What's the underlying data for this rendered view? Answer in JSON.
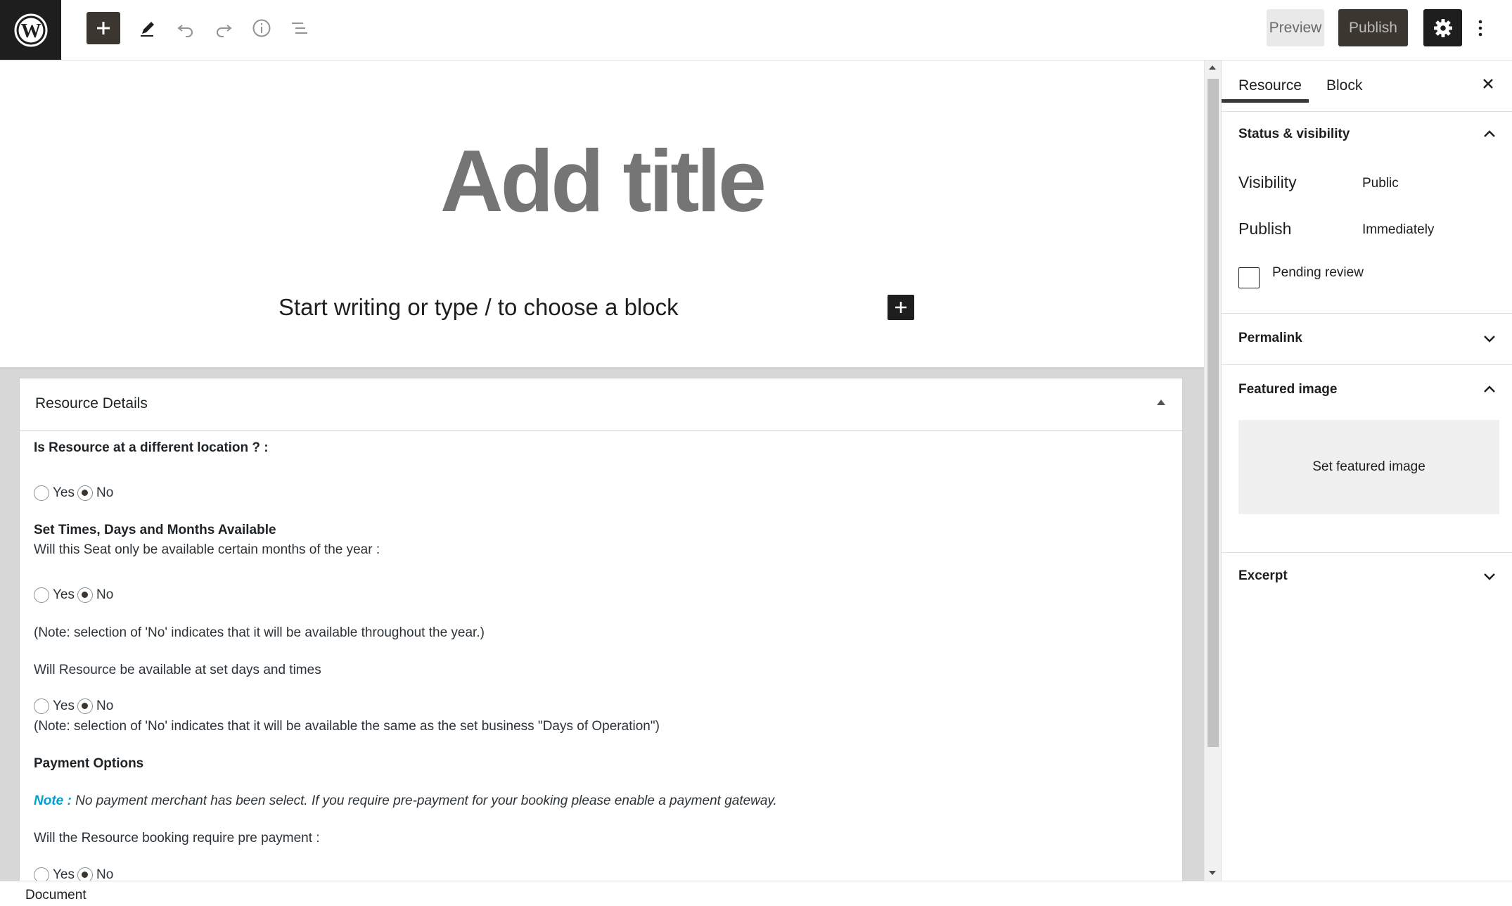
{
  "toolbar": {
    "logo_icon": "wordpress-logo-icon",
    "add_block_icon": "plus-icon",
    "tools_icon": "pencil-icon",
    "undo_icon": "undo-icon",
    "redo_icon": "redo-icon",
    "details_icon": "info-icon",
    "outline_icon": "list-view-icon",
    "preview_label": "Preview",
    "publish_label": "Publish",
    "settings_icon": "gear-icon",
    "options_icon": "more-vertical-icon"
  },
  "editor": {
    "title_placeholder": "Add title",
    "block_prompt": "Start writing or type / to choose a block"
  },
  "metabox": {
    "title": "Resource Details",
    "different_location_label": "Is Resource at a different location ? :",
    "yes": "Yes",
    "no": "No",
    "times_heading": "Set Times, Days and Months Available",
    "months_question": "Will this Seat only be available certain months of the year :",
    "months_note": "(Note: selection of 'No' indicates that it will be available throughout the year.)",
    "days_question": "Will Resource be available at set days and times",
    "days_note": "(Note: selection of 'No' indicates that it will be available the same as the set business \"Days of Operation\")",
    "payment_heading": "Payment Options",
    "payment_note_label": "Note :",
    "payment_note_text": "No payment merchant has been select. If you require pre-payment for your booking please enable a payment gateway.",
    "prepayment_question": "Will the Resource booking require pre payment :",
    "selections": {
      "different_location": "No",
      "months": "No",
      "days": "No",
      "prepayment": "No"
    }
  },
  "sidebar": {
    "tabs": [
      "Resource",
      "Block"
    ],
    "active_tab": "Resource",
    "status_visibility": {
      "heading": "Status & visibility",
      "visibility_label": "Visibility",
      "visibility_value": "Public",
      "publish_label": "Publish",
      "publish_value": "Immediately",
      "pending_review_label": "Pending review",
      "pending_review_checked": false
    },
    "permalink": {
      "heading": "Permalink"
    },
    "featured_image": {
      "heading": "Featured image",
      "set_label": "Set featured image"
    },
    "excerpt": {
      "heading": "Excerpt"
    }
  },
  "footer": {
    "breadcrumb": "Document"
  },
  "colors": {
    "dark": "#1e1e1e",
    "primary_button": "#3c3630",
    "note_accent": "#00a0d2",
    "title_placeholder": "#757575"
  }
}
